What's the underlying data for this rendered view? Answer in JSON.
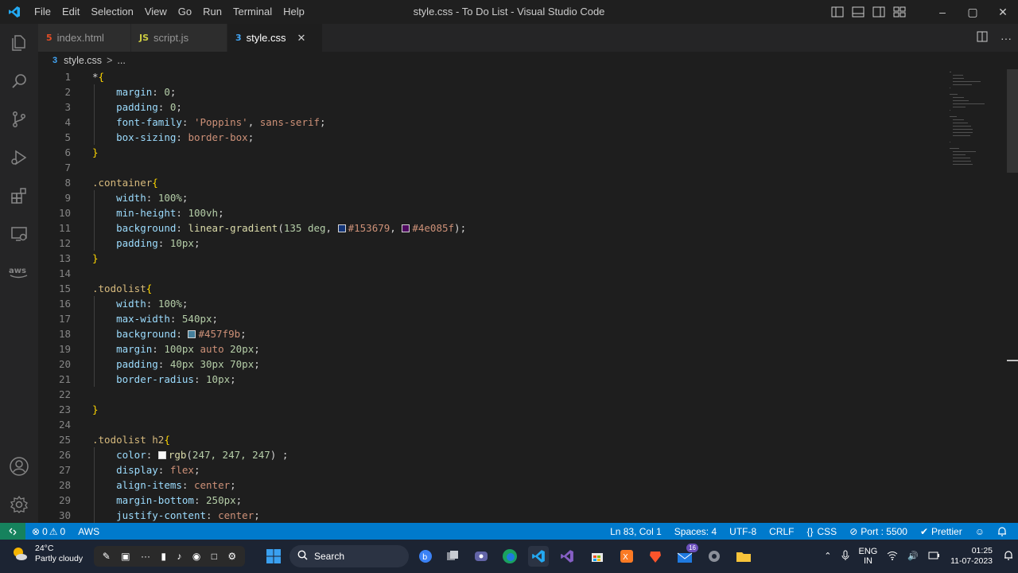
{
  "window": {
    "title": "style.css - To Do List - Visual Studio Code",
    "menu": [
      "File",
      "Edit",
      "Selection",
      "View",
      "Go",
      "Run",
      "Terminal",
      "Help"
    ],
    "controls": {
      "minimize": "–",
      "maximize": "▢",
      "close": "✕"
    }
  },
  "tabs": [
    {
      "label": "index.html",
      "icon": "5",
      "icon_color": "#e44d26",
      "active": false
    },
    {
      "label": "script.js",
      "icon": "JS",
      "icon_color": "#cbcb41",
      "active": false
    },
    {
      "label": "style.css",
      "icon": "3",
      "icon_color": "#42a5f5",
      "active": true
    }
  ],
  "tab_close": "✕",
  "breadcrumb": {
    "icon": "3",
    "file": "style.css",
    "separator": ">",
    "more": "..."
  },
  "editor_lines": [
    {
      "n": "1",
      "tokens": [
        [
          "pl",
          "*"
        ],
        [
          "br",
          "{"
        ]
      ]
    },
    {
      "n": "2",
      "tokens": [
        [
          "pl",
          "    "
        ],
        [
          "prop",
          "margin"
        ],
        [
          "pl",
          ": "
        ],
        [
          "num",
          "0"
        ],
        [
          "pl",
          ";"
        ]
      ]
    },
    {
      "n": "3",
      "tokens": [
        [
          "pl",
          "    "
        ],
        [
          "prop",
          "padding"
        ],
        [
          "pl",
          ": "
        ],
        [
          "num",
          "0"
        ],
        [
          "pl",
          ";"
        ]
      ]
    },
    {
      "n": "4",
      "tokens": [
        [
          "pl",
          "    "
        ],
        [
          "prop",
          "font-family"
        ],
        [
          "pl",
          ": "
        ],
        [
          "val",
          "'Poppins'"
        ],
        [
          "pl",
          ", "
        ],
        [
          "val",
          "sans-serif"
        ],
        [
          "pl",
          ";"
        ]
      ]
    },
    {
      "n": "5",
      "tokens": [
        [
          "pl",
          "    "
        ],
        [
          "prop",
          "box-sizing"
        ],
        [
          "pl",
          ": "
        ],
        [
          "val",
          "border-box"
        ],
        [
          "pl",
          ";"
        ]
      ]
    },
    {
      "n": "6",
      "tokens": [
        [
          "br",
          "}"
        ]
      ]
    },
    {
      "n": "7",
      "tokens": []
    },
    {
      "n": "8",
      "tokens": [
        [
          "sel",
          ".container"
        ],
        [
          "br",
          "{"
        ]
      ]
    },
    {
      "n": "9",
      "tokens": [
        [
          "pl",
          "    "
        ],
        [
          "prop",
          "width"
        ],
        [
          "pl",
          ": "
        ],
        [
          "num",
          "100%"
        ],
        [
          "pl",
          ";"
        ]
      ]
    },
    {
      "n": "10",
      "tokens": [
        [
          "pl",
          "    "
        ],
        [
          "prop",
          "min-height"
        ],
        [
          "pl",
          ": "
        ],
        [
          "num",
          "100vh"
        ],
        [
          "pl",
          ";"
        ]
      ]
    },
    {
      "n": "11",
      "tokens": [
        [
          "pl",
          "    "
        ],
        [
          "prop",
          "background"
        ],
        [
          "pl",
          ": "
        ],
        [
          "fn",
          "linear-gradient"
        ],
        [
          "pl",
          "("
        ],
        [
          "num",
          "135 deg"
        ],
        [
          "pl",
          ", "
        ],
        [
          "swatch",
          "#153679"
        ],
        [
          "val",
          "#153679"
        ],
        [
          "pl",
          ", "
        ],
        [
          "swatch",
          "#4e085f"
        ],
        [
          "val",
          "#4e085f"
        ],
        [
          "pl",
          ");"
        ]
      ]
    },
    {
      "n": "12",
      "tokens": [
        [
          "pl",
          "    "
        ],
        [
          "prop",
          "padding"
        ],
        [
          "pl",
          ": "
        ],
        [
          "num",
          "10px"
        ],
        [
          "pl",
          ";"
        ]
      ]
    },
    {
      "n": "13",
      "tokens": [
        [
          "br",
          "}"
        ]
      ]
    },
    {
      "n": "14",
      "tokens": []
    },
    {
      "n": "15",
      "tokens": [
        [
          "sel",
          ".todolist"
        ],
        [
          "br",
          "{"
        ]
      ]
    },
    {
      "n": "16",
      "tokens": [
        [
          "pl",
          "    "
        ],
        [
          "prop",
          "width"
        ],
        [
          "pl",
          ": "
        ],
        [
          "num",
          "100%"
        ],
        [
          "pl",
          ";"
        ]
      ]
    },
    {
      "n": "17",
      "tokens": [
        [
          "pl",
          "    "
        ],
        [
          "prop",
          "max-width"
        ],
        [
          "pl",
          ": "
        ],
        [
          "num",
          "540px"
        ],
        [
          "pl",
          ";"
        ]
      ]
    },
    {
      "n": "18",
      "tokens": [
        [
          "pl",
          "    "
        ],
        [
          "prop",
          "background"
        ],
        [
          "pl",
          ": "
        ],
        [
          "swatch",
          "#457f9b"
        ],
        [
          "val",
          "#457f9b"
        ],
        [
          "pl",
          ";"
        ]
      ]
    },
    {
      "n": "19",
      "tokens": [
        [
          "pl",
          "    "
        ],
        [
          "prop",
          "margin"
        ],
        [
          "pl",
          ": "
        ],
        [
          "num",
          "100px"
        ],
        [
          "pl",
          " "
        ],
        [
          "val",
          "auto"
        ],
        [
          "pl",
          " "
        ],
        [
          "num",
          "20px"
        ],
        [
          "pl",
          ";"
        ]
      ]
    },
    {
      "n": "20",
      "tokens": [
        [
          "pl",
          "    "
        ],
        [
          "prop",
          "padding"
        ],
        [
          "pl",
          ": "
        ],
        [
          "num",
          "40px 30px 70px"
        ],
        [
          "pl",
          ";"
        ]
      ]
    },
    {
      "n": "21",
      "tokens": [
        [
          "pl",
          "    "
        ],
        [
          "prop",
          "border-radius"
        ],
        [
          "pl",
          ": "
        ],
        [
          "num",
          "10px"
        ],
        [
          "pl",
          ";"
        ]
      ]
    },
    {
      "n": "22",
      "tokens": []
    },
    {
      "n": "23",
      "tokens": [
        [
          "br",
          "}"
        ]
      ]
    },
    {
      "n": "24",
      "tokens": []
    },
    {
      "n": "25",
      "tokens": [
        [
          "sel",
          ".todolist h2"
        ],
        [
          "br",
          "{"
        ]
      ]
    },
    {
      "n": "26",
      "tokens": [
        [
          "pl",
          "    "
        ],
        [
          "prop",
          "color"
        ],
        [
          "pl",
          ": "
        ],
        [
          "swatch",
          "#f7f7f7"
        ],
        [
          "fn",
          "rgb"
        ],
        [
          "pl",
          "("
        ],
        [
          "num",
          "247, 247, 247"
        ],
        [
          "pl",
          ") ;"
        ]
      ]
    },
    {
      "n": "27",
      "tokens": [
        [
          "pl",
          "    "
        ],
        [
          "prop",
          "display"
        ],
        [
          "pl",
          ": "
        ],
        [
          "val",
          "flex"
        ],
        [
          "pl",
          ";"
        ]
      ]
    },
    {
      "n": "28",
      "tokens": [
        [
          "pl",
          "    "
        ],
        [
          "prop",
          "align-items"
        ],
        [
          "pl",
          ": "
        ],
        [
          "val",
          "center"
        ],
        [
          "pl",
          ";"
        ]
      ]
    },
    {
      "n": "29",
      "tokens": [
        [
          "pl",
          "    "
        ],
        [
          "prop",
          "margin-bottom"
        ],
        [
          "pl",
          ": "
        ],
        [
          "num",
          "250px"
        ],
        [
          "pl",
          ";"
        ]
      ]
    },
    {
      "n": "30",
      "tokens": [
        [
          "pl",
          "    "
        ],
        [
          "prop",
          "justify-content"
        ],
        [
          "pl",
          ": "
        ],
        [
          "val",
          "center"
        ],
        [
          "pl",
          ";"
        ]
      ]
    }
  ],
  "status": {
    "remote_icon": "remote-icon",
    "errors": "0",
    "warnings": "0",
    "aws": "AWS",
    "position": "Ln 83, Col 1",
    "spaces": "Spaces: 4",
    "encoding": "UTF-8",
    "eol": "CRLF",
    "language": "CSS",
    "port": "Port : 5500",
    "prettier": "Prettier"
  },
  "taskbar": {
    "temp": "24°C",
    "weather": "Partly cloudy",
    "search": "Search",
    "lang": "ENG",
    "region": "IN",
    "time": "01:25",
    "date": "11-07-2023",
    "mail_badge": "16"
  },
  "colors": {
    "statusbar": "#007acc",
    "editor_bg": "#1e1e1e",
    "activitybar": "#252526"
  }
}
